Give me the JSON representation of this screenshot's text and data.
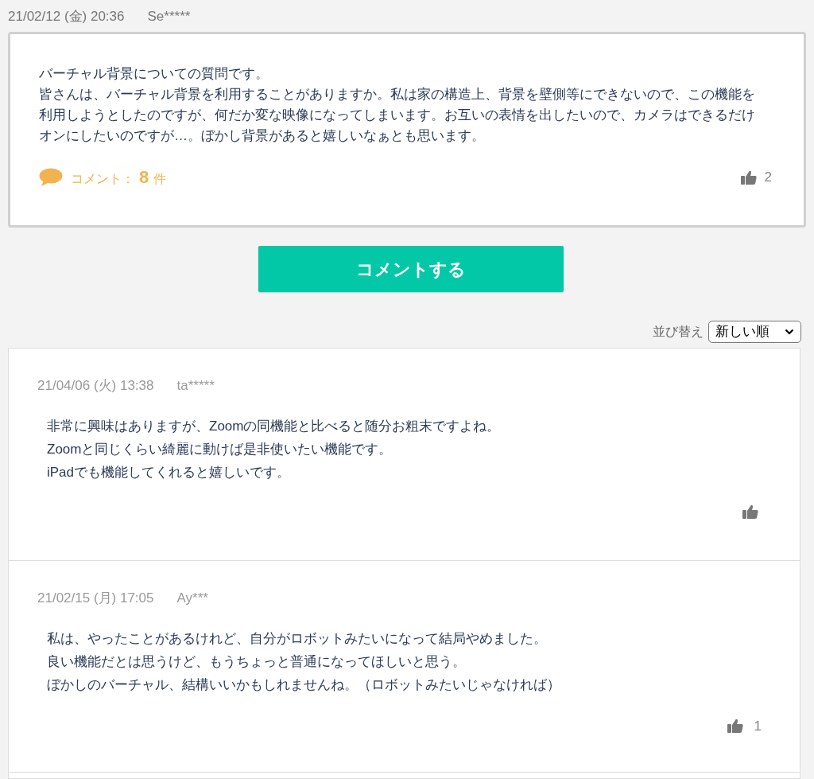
{
  "question": {
    "date": "21/02/12 (金) 20:36",
    "user": "Se*****",
    "lines": [
      "バーチャル背景についての質問です。",
      "皆さんは、バーチャル背景を利用することがありますか。私は家の構造上、背景を壁側等にできないので、この機能を利用しようとしたのですが、何だか変な映像になってしまいます。お互いの表情を出したいので、カメラはできるだけオンにしたいのですが…。ぼかし背景があると嬉しいなぁとも思います。"
    ],
    "comment_label": "コメント：",
    "comment_count": "8",
    "comment_unit": "件",
    "likes": "2"
  },
  "comment_button": "コメントする",
  "sort": {
    "label": "並び替え",
    "value": "新しい順"
  },
  "comments": [
    {
      "date": "21/04/06 (火) 13:38",
      "user": "ta*****",
      "lines": [
        "非常に興味はありますが、Zoomの同機能と比べると随分お粗末ですよね。",
        "Zoomと同じくらい綺麗に動けば是非使いたい機能です。",
        "iPadでも機能してくれると嬉しいです。"
      ]
    },
    {
      "date": "21/02/15 (月) 17:05",
      "user": "Ay***",
      "lines": [
        "私は、やったことがあるけれど、自分がロボットみたいになって結局やめました。",
        "良い機能だとは思うけど、もうちょっと普通になってほしいと思う。",
        "ぼかしのバーチャル、結構いいかもしれませんね。（ロボットみたいじゃなければ）"
      ],
      "likes": "1"
    }
  ]
}
